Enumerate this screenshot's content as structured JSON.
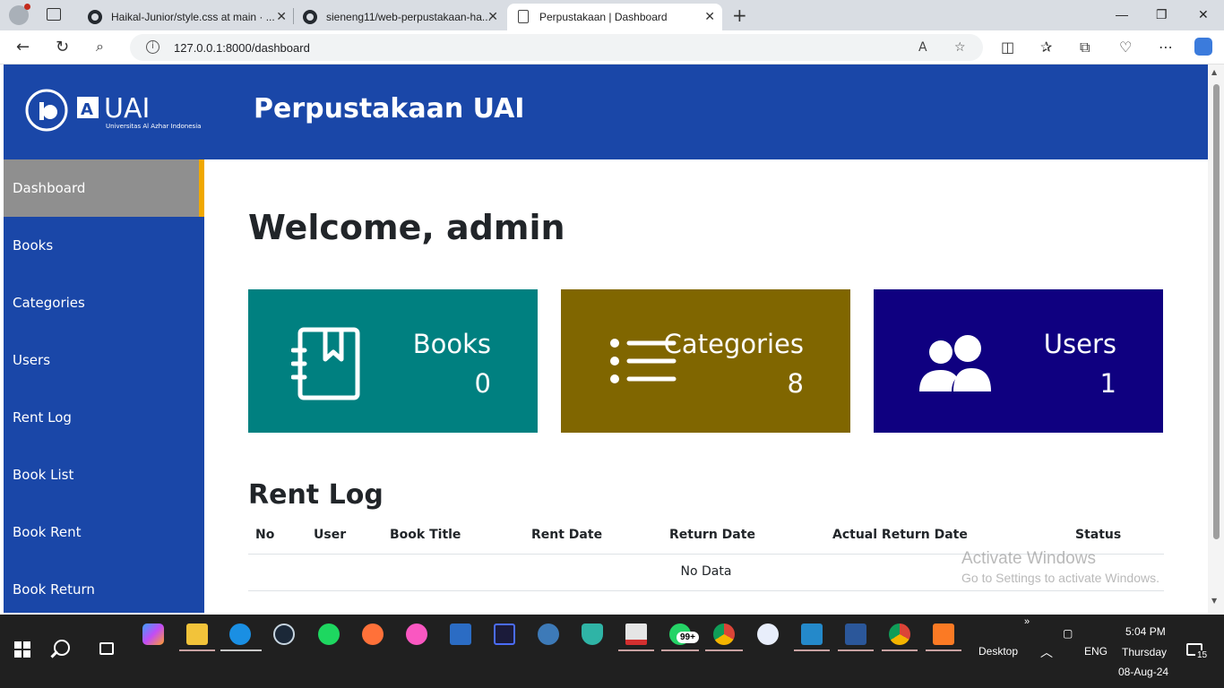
{
  "browser": {
    "tabs": [
      {
        "title": "Haikal-Junior/style.css at main · ..."
      },
      {
        "title": "sieneng11/web-perpustakaan-ha..."
      },
      {
        "title": "Perpustakaan | Dashboard"
      }
    ],
    "url": "127.0.0.1:8000/dashboard"
  },
  "header": {
    "title": "Perpustakaan UAI",
    "logo_text": "UAI",
    "logo_subtext": "Universitas Al Azhar Indonesia"
  },
  "sidebar": {
    "items": [
      {
        "label": "Dashboard"
      },
      {
        "label": "Books"
      },
      {
        "label": "Categories"
      },
      {
        "label": "Users"
      },
      {
        "label": "Rent Log"
      },
      {
        "label": "Book List"
      },
      {
        "label": "Book Rent"
      },
      {
        "label": "Book Return"
      }
    ]
  },
  "main": {
    "welcome": "Welcome, admin",
    "cards": [
      {
        "label": "Books",
        "value": "0",
        "color": "#008080",
        "icon": "book-icon"
      },
      {
        "label": "Categories",
        "value": "8",
        "color": "#806600",
        "icon": "list-icon"
      },
      {
        "label": "Users",
        "value": "1",
        "color": "#0f0080",
        "icon": "users-icon"
      }
    ],
    "rent_log": {
      "title": "Rent Log",
      "columns": [
        "No",
        "User",
        "Book Title",
        "Rent Date",
        "Return Date",
        "Actual Return Date",
        "Status"
      ],
      "empty_text": "No Data"
    }
  },
  "watermark": {
    "line1": "Activate Windows",
    "line2": "Go to Settings to activate Windows."
  },
  "taskbar": {
    "whatsapp_badge": "99+",
    "desktop_label": "Desktop",
    "language": "ENG",
    "time": "5:04 PM",
    "day": "Thursday",
    "date": "08-Aug-24",
    "notifications": "15"
  },
  "colors": {
    "primary": "#1a47a8",
    "sidebar_active": "#8f8f8f",
    "accent": "#f0a800"
  }
}
